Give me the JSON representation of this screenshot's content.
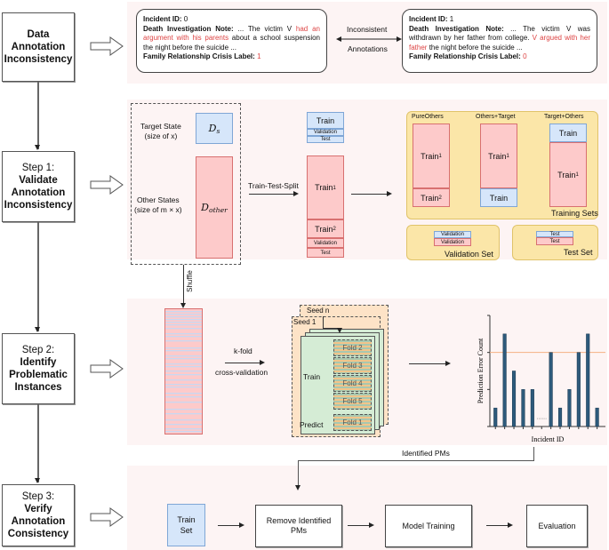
{
  "steps": [
    {
      "id": "data",
      "line1": "",
      "bold": [
        "Data",
        "Annotation",
        "Inconsistency"
      ]
    },
    {
      "id": "step1",
      "line1": "Step 1:",
      "bold": [
        "Validate",
        "Annotation",
        "Inconsistency"
      ]
    },
    {
      "id": "step2",
      "line1": "Step 2:",
      "bold": [
        "Identify",
        "Problematic",
        "Instances"
      ]
    },
    {
      "id": "step3",
      "line1": "Step 3:",
      "bold": [
        "Verify",
        "Annotation",
        "Consistency"
      ]
    }
  ],
  "notes": [
    {
      "incident_label": "Incident ID",
      "incident_id": "0",
      "note_label": "Death Investigation Note",
      "note_pre": "... The victim V ",
      "note_highlight": "had an argument with his parents",
      "note_post": " about a school suspension the night before the suicide ...",
      "crisis_label": "Family Relationship Crisis Label",
      "crisis_value": "1"
    },
    {
      "incident_label": "Incident ID",
      "incident_id": "1",
      "note_label": "Death Investigation Note:",
      "note_pre": " ... The victim V was withdrawn by her father from college. ",
      "note_highlight": "V argued with her father",
      "note_post": " the night before the suicide ...",
      "crisis_label": "Family Relationship Crisis Label",
      "crisis_value": "0"
    }
  ],
  "inconsistent": {
    "top": "Inconsistent",
    "bottom": "Annotations"
  },
  "step1": {
    "target_state": "Target State",
    "target_size": "(size of x)",
    "target_symbol": "D",
    "target_sub": "s",
    "other_states": "Other States",
    "other_size": "(size of m × x)",
    "other_symbol": "D",
    "other_sub": "other",
    "split_label": "Train-Test-Split",
    "target_split": [
      "Train",
      "Validation",
      "Test"
    ],
    "other_split": {
      "train1": "Train",
      "train2": "Train",
      "validation": "Validation",
      "test": "Test"
    },
    "training_sets": {
      "title": "Training Sets",
      "columns": [
        {
          "title": "PureOthers",
          "parts": [
            "Train1",
            "Train2"
          ]
        },
        {
          "title": "Others+Target",
          "parts": [
            "Train1",
            "Train"
          ]
        },
        {
          "title": "Target+Others",
          "parts": [
            "Train",
            "Train1"
          ]
        }
      ]
    },
    "validation_set": {
      "title": "Validation Set",
      "parts": [
        "Validation",
        "Validation"
      ]
    },
    "test_set": {
      "title": "Test Set",
      "parts": [
        "Test",
        "Test"
      ]
    }
  },
  "step2": {
    "shuffle": "Shuffle",
    "kfold": "k-fold",
    "cv": "cross-validation",
    "seed_n": "Seed n",
    "seed_1": "Seed 1",
    "train": "Train",
    "predict": "Predict",
    "folds_train": [
      "Fold 2",
      "Fold 3",
      "Fold 4",
      "Fold 5"
    ],
    "fold_predict": "Fold 1",
    "identified": "Identified PMs"
  },
  "chart_data": {
    "type": "bar",
    "title": "",
    "xlabel": "Incident ID",
    "ylabel": "Prediction Error Count",
    "ylim": [
      0,
      6
    ],
    "values": [
      1,
      5,
      3,
      2,
      2,
      null,
      4,
      1,
      2,
      4,
      5,
      1
    ],
    "gap_marker": "......",
    "threshold": 4,
    "bar_color": "#2d5a7b",
    "threshold_color": "#f4b183"
  },
  "step3": {
    "train_set": [
      "Train",
      "Set"
    ],
    "remove": [
      "Remove Identified",
      "PMs"
    ],
    "model_training": "Model Training",
    "evaluation": "Evaluation"
  }
}
